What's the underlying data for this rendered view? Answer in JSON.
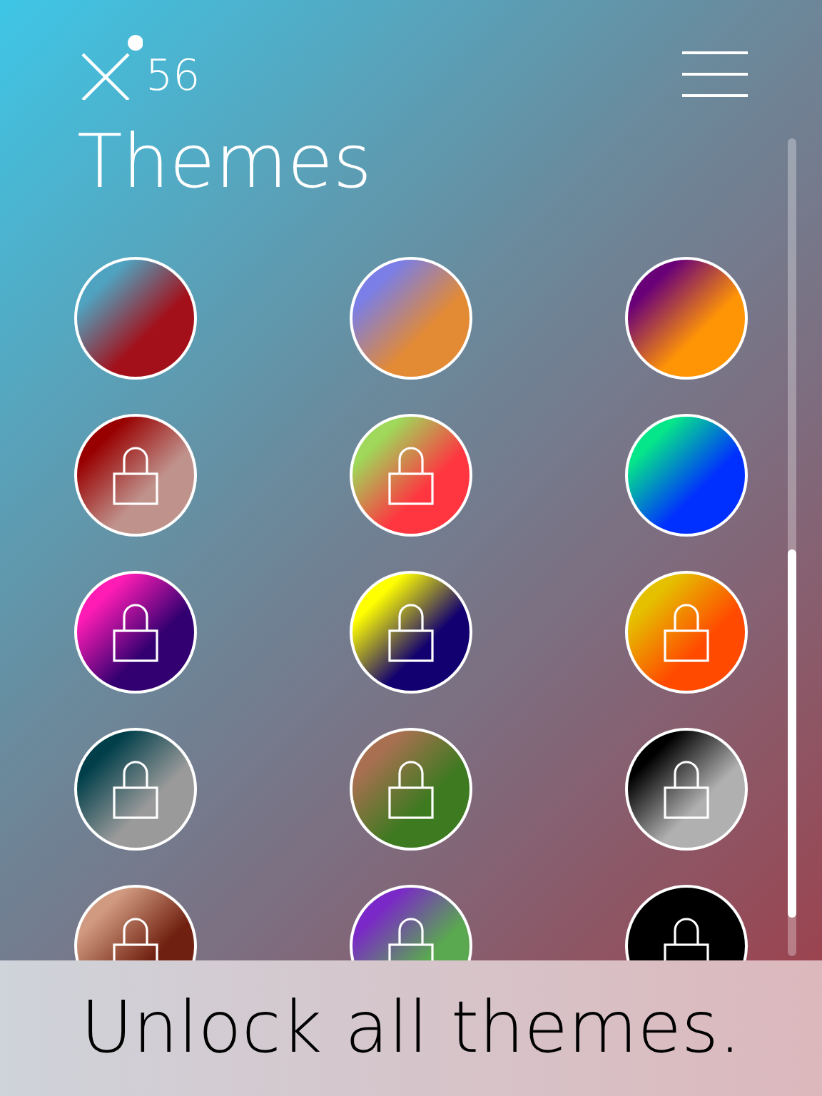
{
  "logo": {
    "text": "56"
  },
  "title": "Themes",
  "themes": [
    {
      "gradient": [
        {
          "color": "#4fa3c0"
        },
        {
          "color": "#a3101a"
        }
      ],
      "locked": false
    },
    {
      "gradient": [
        {
          "color": "#7a7ee6"
        },
        {
          "color": "#e38a35"
        }
      ],
      "locked": false
    },
    {
      "gradient": [
        {
          "color": "#6a0078"
        },
        {
          "color": "#ff9505"
        }
      ],
      "locked": false
    },
    {
      "gradient": [
        {
          "color": "#980000"
        },
        {
          "color": "#c0928c"
        }
      ],
      "locked": true
    },
    {
      "gradient": [
        {
          "color": "#9fd85a"
        },
        {
          "color": "#ff3540"
        }
      ],
      "locked": true
    },
    {
      "gradient": [
        {
          "color": "#05e58a"
        },
        {
          "color": "#0030ff"
        }
      ],
      "locked": false
    },
    {
      "gradient": [
        {
          "color": "#ff1cb5"
        },
        {
          "color": "#320070"
        }
      ],
      "locked": true
    },
    {
      "gradient": [
        {
          "color": "#ffff00"
        },
        {
          "color": "#120070"
        }
      ],
      "locked": true
    },
    {
      "gradient": [
        {
          "color": "#e5c000"
        },
        {
          "color": "#ff4a00"
        }
      ],
      "locked": true
    },
    {
      "gradient": [
        {
          "color": "#003f4a"
        },
        {
          "color": "#9a9a9a"
        }
      ],
      "locked": true
    },
    {
      "gradient": [
        {
          "color": "#a87050"
        },
        {
          "color": "#3d7a20"
        }
      ],
      "locked": true
    },
    {
      "gradient": [
        {
          "color": "#000000"
        },
        {
          "color": "#b0b0b0"
        }
      ],
      "locked": true
    },
    {
      "gradient": [
        {
          "color": "#d09a80"
        },
        {
          "color": "#702010"
        }
      ],
      "locked": true
    },
    {
      "gradient": [
        {
          "color": "#7a28c8"
        },
        {
          "color": "#5aa850"
        }
      ],
      "locked": true
    },
    {
      "gradient": [
        {
          "color": "#000000"
        },
        {
          "color": "#000000"
        }
      ],
      "locked": true
    }
  ],
  "banner": "Unlock all themes."
}
